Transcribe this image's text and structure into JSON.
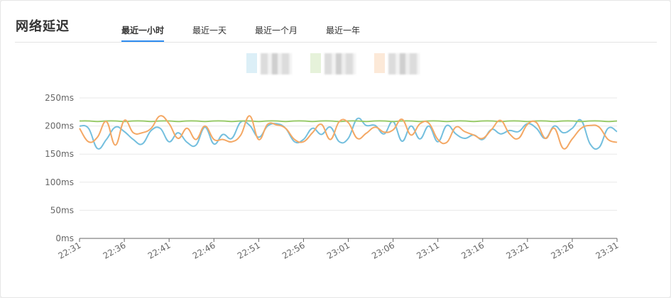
{
  "header": {
    "title": "网络延迟"
  },
  "tabs": [
    {
      "label": "最近一小时",
      "active": true
    },
    {
      "label": "最近一天",
      "active": false
    },
    {
      "label": "最近一个月",
      "active": false
    },
    {
      "label": "最近一年",
      "active": false
    }
  ],
  "legend": [
    {
      "color": "#74bfde",
      "label": ""
    },
    {
      "color": "#9acb6b",
      "label": ""
    },
    {
      "color": "#f4a865",
      "label": ""
    }
  ],
  "chart_data": {
    "type": "line",
    "title": "",
    "xlabel": "",
    "ylabel": "",
    "ylim": [
      0,
      250
    ],
    "yticks": [
      "0ms",
      "50ms",
      "100ms",
      "150ms",
      "200ms",
      "250ms"
    ],
    "x": [
      "22:31",
      "22:36",
      "22:41",
      "22:46",
      "22:51",
      "22:56",
      "23:01",
      "23:06",
      "23:11",
      "23:16",
      "23:21",
      "23:26",
      "23:31"
    ],
    "grid": true,
    "series": [
      {
        "color": "#74bfde",
        "values": [
          200,
          196,
          160,
          176,
          198,
          190,
          176,
          168,
          192,
          196,
          172,
          188,
          171,
          166,
          198,
          168,
          185,
          178,
          207,
          201,
          180,
          200,
          204,
          196,
          172,
          176,
          196,
          185,
          198,
          172,
          178,
          213,
          201,
          201,
          186,
          208,
          173,
          200,
          177,
          200,
          172,
          201,
          186,
          178,
          184,
          176,
          194,
          186,
          192,
          190,
          204,
          196,
          178,
          200,
          188,
          196,
          210,
          168,
          162,
          196,
          190
        ]
      },
      {
        "color": "#9acb6b",
        "values": [
          209,
          209,
          208,
          209,
          209,
          208,
          209,
          209,
          208,
          209,
          209,
          208,
          209,
          209,
          208,
          209,
          209,
          208,
          209,
          209,
          208,
          209,
          209,
          208,
          209,
          209,
          208,
          209,
          209,
          208,
          209,
          209,
          208,
          209,
          209,
          208,
          209,
          209,
          208,
          209,
          209,
          208,
          209,
          209,
          208,
          209,
          209,
          208,
          209,
          209,
          208,
          209,
          209,
          208,
          209,
          209,
          208,
          209,
          209,
          208,
          209
        ]
      },
      {
        "color": "#f4a865",
        "values": [
          196,
          172,
          180,
          208,
          166,
          210,
          188,
          188,
          196,
          218,
          204,
          178,
          196,
          176,
          200,
          176,
          176,
          172,
          184,
          218,
          176,
          203,
          202,
          196,
          176,
          172,
          188,
          203,
          176,
          208,
          206,
          178,
          187,
          198,
          189,
          193,
          212,
          184,
          204,
          205,
          176,
          171,
          198,
          190,
          184,
          178,
          194,
          210,
          186,
          178,
          203,
          206,
          178,
          196,
          160,
          177,
          196,
          201,
          198,
          176,
          171
        ]
      }
    ]
  }
}
